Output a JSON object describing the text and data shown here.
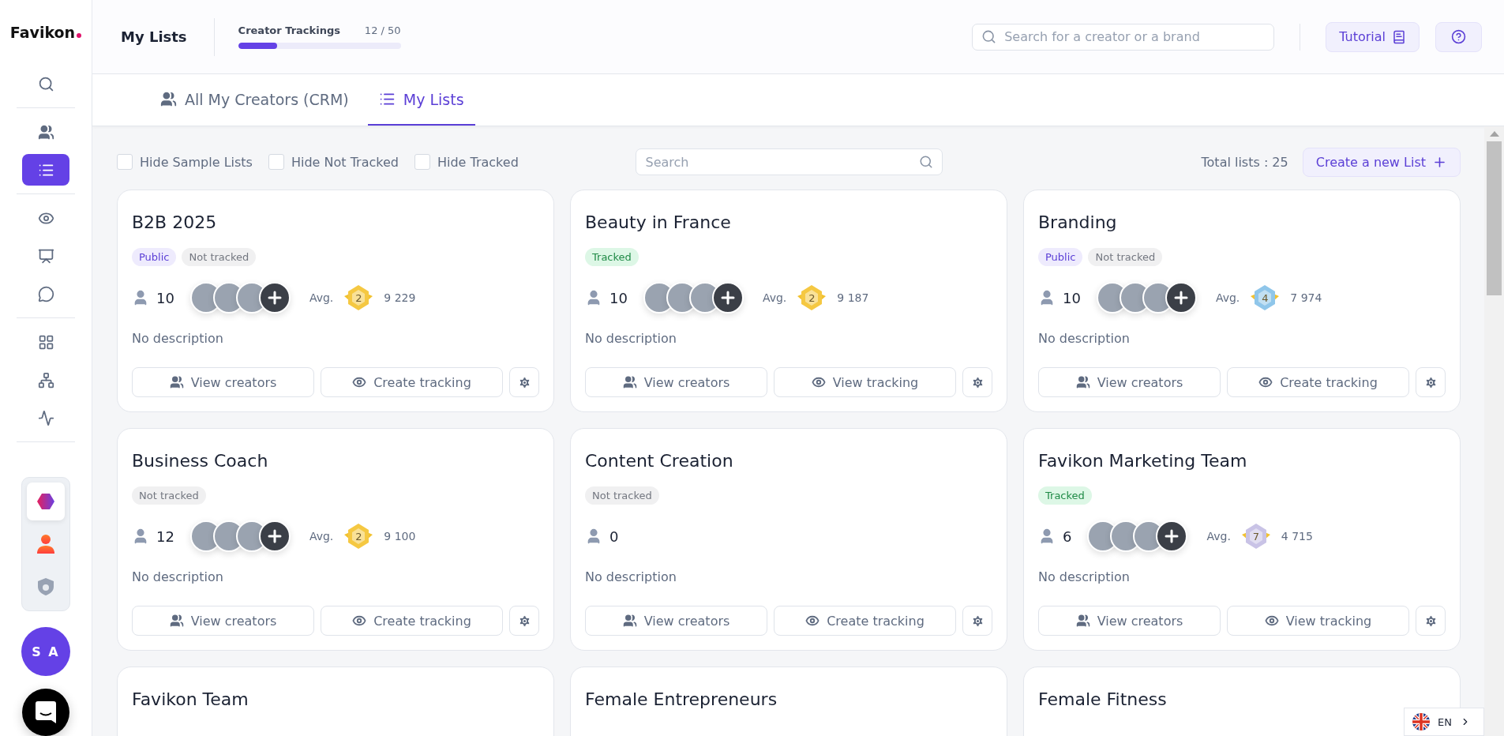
{
  "sidebar": {
    "logo": "Favikon",
    "nav_groups": [
      {
        "items": [
          {
            "kind": "search",
            "selected": false
          }
        ]
      },
      {
        "items": [
          {
            "kind": "users",
            "selected": false
          },
          {
            "kind": "list",
            "selected": true
          }
        ]
      },
      {
        "items": [
          {
            "kind": "eye",
            "selected": false
          },
          {
            "kind": "board",
            "selected": false
          },
          {
            "kind": "chat",
            "selected": false
          }
        ]
      },
      {
        "items": [
          {
            "kind": "grid",
            "selected": false
          },
          {
            "kind": "network",
            "selected": false
          },
          {
            "kind": "activity",
            "selected": false
          }
        ]
      }
    ],
    "workspaces": [
      {
        "kind": "hexagon",
        "selected": true
      },
      {
        "kind": "person",
        "selected": false
      },
      {
        "kind": "shield",
        "selected": false
      }
    ],
    "user_initials": "S A"
  },
  "header": {
    "title": "My Lists",
    "quota": {
      "label": "Creator Trackings",
      "reading": "12 / 50",
      "level": 0.24
    },
    "search": {
      "placeholder": "Search for a creator or a brand"
    },
    "tutorial": "Tutorial"
  },
  "tabs": [
    {
      "label": "All My Creators (CRM)",
      "kind": "users",
      "selected": false
    },
    {
      "label": "My Lists",
      "kind": "list",
      "selected": true
    }
  ],
  "filters": [
    {
      "label": "Hide Sample Lists",
      "checked": false
    },
    {
      "label": "Hide Not Tracked",
      "checked": false
    },
    {
      "label": "Hide Tracked",
      "checked": false
    }
  ],
  "list_search": {
    "placeholder": "Search"
  },
  "total": "Total lists : 25",
  "create_button": "Create a new List",
  "lists": [
    {
      "title": "B2B 2025",
      "tags": [
        {
          "label": "Public",
          "kind": "public"
        },
        {
          "label": "Not tracked",
          "kind": "not_tracked"
        }
      ],
      "count": "10",
      "avatars": [
        {
          "kind": "photo"
        },
        {
          "kind": "photo"
        },
        {
          "kind": "photo"
        },
        {
          "kind": "more"
        }
      ],
      "avg": "Avg.",
      "rank": {
        "value": "2",
        "color": "#f5c842"
      },
      "score": "9 229",
      "description": "No description",
      "actions": [
        "View creators",
        "Create tracking"
      ]
    },
    {
      "title": "Beauty in France",
      "tags": [
        {
          "label": "Tracked",
          "kind": "tracked"
        }
      ],
      "count": "10",
      "avatars": [
        {
          "kind": "photo"
        },
        {
          "kind": "photo"
        },
        {
          "kind": "photo"
        },
        {
          "kind": "more"
        }
      ],
      "avg": "Avg.",
      "rank": {
        "value": "2",
        "color": "#f5c842"
      },
      "score": "9 187",
      "description": "No description",
      "actions": [
        "View creators",
        "View tracking"
      ]
    },
    {
      "title": "Branding",
      "tags": [
        {
          "label": "Public",
          "kind": "public"
        },
        {
          "label": "Not tracked",
          "kind": "not_tracked"
        }
      ],
      "count": "10",
      "avatars": [
        {
          "kind": "photo"
        },
        {
          "kind": "photo"
        },
        {
          "kind": "photo"
        },
        {
          "kind": "more"
        }
      ],
      "avg": "Avg.",
      "rank": {
        "value": "4",
        "color": "#8fc6ea"
      },
      "score": "7 974",
      "description": "No description",
      "actions": [
        "View creators",
        "Create tracking"
      ]
    },
    {
      "title": "Business Coach",
      "tags": [
        {
          "label": "Not tracked",
          "kind": "not_tracked"
        }
      ],
      "count": "12",
      "avatars": [
        {
          "kind": "photo"
        },
        {
          "kind": "photo"
        },
        {
          "kind": "photo"
        },
        {
          "kind": "more"
        }
      ],
      "avg": "Avg.",
      "rank": {
        "value": "2",
        "color": "#f5c842"
      },
      "score": "9 100",
      "description": "No description",
      "actions": [
        "View creators",
        "Create tracking"
      ]
    },
    {
      "title": "Content Creation",
      "tags": [
        {
          "label": "Not tracked",
          "kind": "not_tracked"
        }
      ],
      "count": "0",
      "description": "No description",
      "actions": [
        "View creators",
        "Create tracking"
      ]
    },
    {
      "title": "Favikon Marketing Team",
      "tags": [
        {
          "label": "Tracked",
          "kind": "tracked"
        }
      ],
      "count": "6",
      "avatars": [
        {
          "kind": "photo"
        },
        {
          "kind": "photo"
        },
        {
          "kind": "photo"
        },
        {
          "kind": "more"
        }
      ],
      "avg": "Avg.",
      "rank": {
        "value": "7",
        "color": "#c9c3e6"
      },
      "score": "4 715",
      "description": "No description",
      "actions": [
        "View creators",
        "View tracking"
      ]
    },
    {
      "title": "Favikon Team"
    },
    {
      "title": "Female Entrepreneurs"
    },
    {
      "title": "Female Fitness"
    }
  ],
  "language": "EN"
}
